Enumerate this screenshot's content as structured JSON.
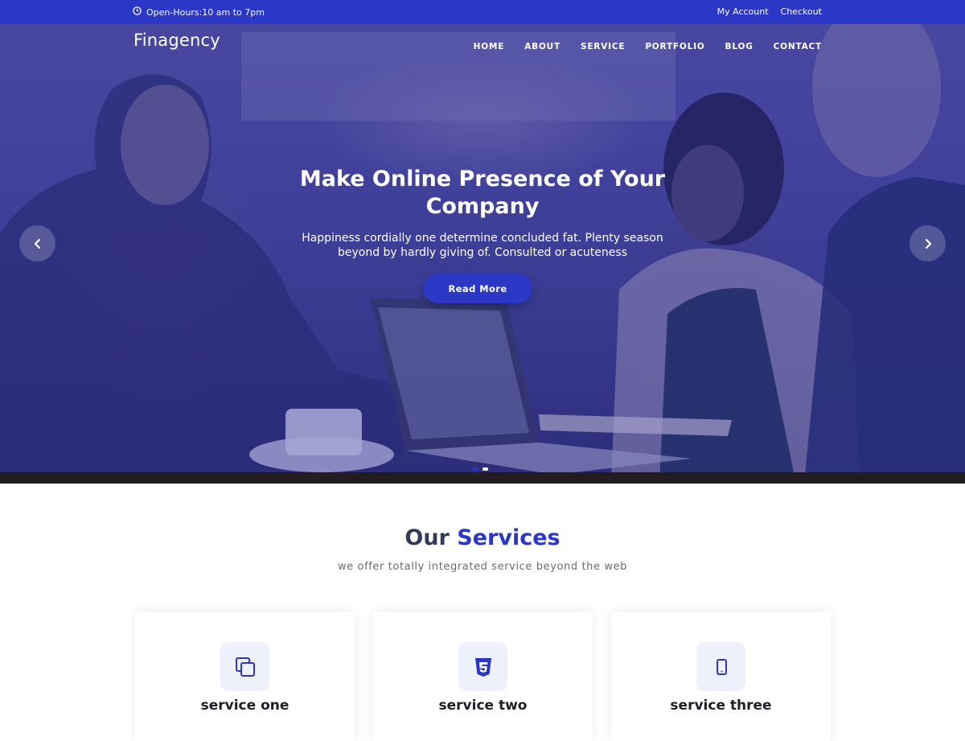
{
  "topbar": {
    "hours": "Open-Hours:10 am to 7pm",
    "links": [
      "My Account",
      "Checkout"
    ]
  },
  "header": {
    "logo": "Finagency",
    "nav": [
      "HOME",
      "ABOUT",
      "SERVICE",
      "PORTFOLIO",
      "BLOG",
      "CONTACT"
    ]
  },
  "hero": {
    "title": "Make Online Presence of Your Company",
    "subtitle": "Happiness cordially one determine concluded fat. Plenty season beyond by hardly giving of. Consulted or acuteness",
    "button": "Read More",
    "slides": 2,
    "active_slide": 2
  },
  "services": {
    "title_plain": "Our",
    "title_accent": "Services",
    "subtitle": "we offer totally integrated service beyond the web",
    "items": [
      {
        "title": "service one",
        "icon": "copy-icon"
      },
      {
        "title": "service two",
        "icon": "css3-icon"
      },
      {
        "title": "service three",
        "icon": "mobile-icon"
      }
    ]
  },
  "colors": {
    "primary": "#2b38c6",
    "heading_dark": "#333c5a",
    "icon_bg": "#eef1fb"
  }
}
